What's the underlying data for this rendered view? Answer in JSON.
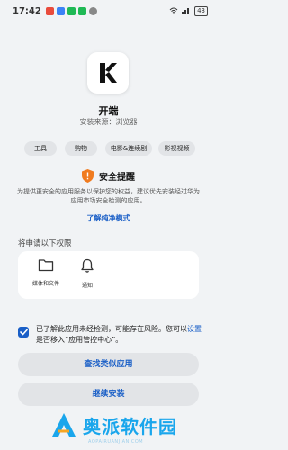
{
  "status_bar": {
    "time": "17:42",
    "battery": "43"
  },
  "app": {
    "name": "开端",
    "install_source": "安装来源：浏览器",
    "icon": "k-app-logo"
  },
  "tags": [
    "工具",
    "购物",
    "电影&连续剧",
    "影视视频"
  ],
  "security": {
    "icon": "shield-warning-icon",
    "title": "安全提醒",
    "description": "为提供更安全的应用服务以保护您的权益，建议优先安装经过华为应用市场安全检测的应用。",
    "link": "了解纯净模式"
  },
  "permissions": {
    "heading": "将申请以下权限",
    "items": [
      {
        "label": "媒体和文件",
        "icon": "folder-icon"
      },
      {
        "label": "通知",
        "icon": "bell-icon"
      }
    ]
  },
  "consent": {
    "checked": true,
    "text_before": "已了解此应用未经检测，可能存在风险。您可以",
    "link": "设置",
    "text_after": "是否移入“应用管控中心”。"
  },
  "buttons": {
    "find_similar": "查找类似应用",
    "continue_install": "继续安装"
  },
  "watermark": {
    "text": "奥派软件园",
    "sub": "AOPAIRUANJIAN.COM"
  }
}
